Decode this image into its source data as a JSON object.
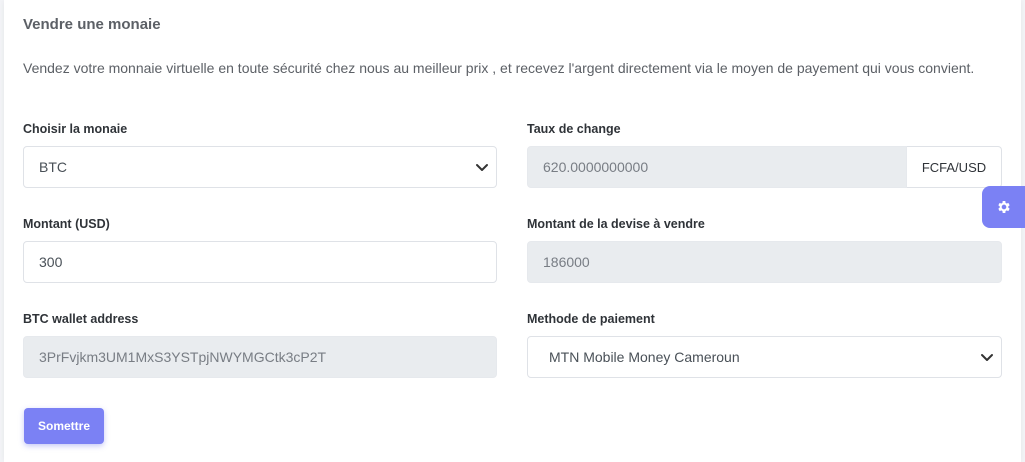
{
  "card": {
    "title": "Vendre une monaie",
    "description": "Vendez votre monnaie virtuelle en toute sécurité chez nous au meilleur prix , et recevez l'argent directement via le moyen de payement qui vous convient."
  },
  "form": {
    "currency": {
      "label": "Choisir la monaie",
      "value": "BTC"
    },
    "exchange_rate": {
      "label": "Taux de change",
      "value": "620.0000000000",
      "unit": "FCFA/USD"
    },
    "amount": {
      "label": "Montant (USD)",
      "value": "300"
    },
    "amount_to_sell": {
      "label": "Montant de la devise à vendre",
      "value": "186000"
    },
    "wallet": {
      "label": "BTC wallet address",
      "value": "3PrFvjkm3UM1MxS3YSTpjNWYMGCtk3cP2T"
    },
    "payment_method": {
      "label": "Methode de paiement",
      "value": "MTN Mobile Money Cameroun"
    },
    "submit_label": "Somettre"
  },
  "icons": {
    "select": "chevron-down-icon",
    "settings": "gear-icon"
  },
  "colors": {
    "accent": "#7b81f4",
    "disabled_bg": "#e9ecef"
  }
}
